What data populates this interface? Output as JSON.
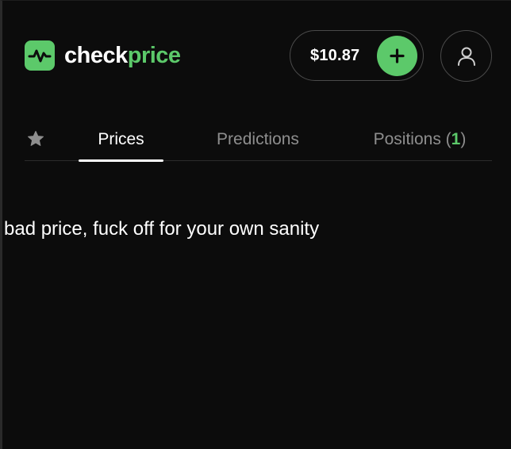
{
  "brand": {
    "logo_icon": "pulse-icon",
    "name_part1": "check",
    "name_part2": "price",
    "accent_color": "#5cc96a"
  },
  "header": {
    "balance": "$10.87",
    "add_icon": "plus-icon",
    "profile_icon": "user-icon"
  },
  "tabs": {
    "favorites_icon": "star-icon",
    "items": [
      {
        "label": "Prices",
        "active": true
      },
      {
        "label": "Predictions",
        "active": false
      },
      {
        "label": "Positions",
        "count": "1",
        "active": false
      }
    ]
  },
  "content": {
    "message": "bad price, fuck off for your own sanity"
  }
}
